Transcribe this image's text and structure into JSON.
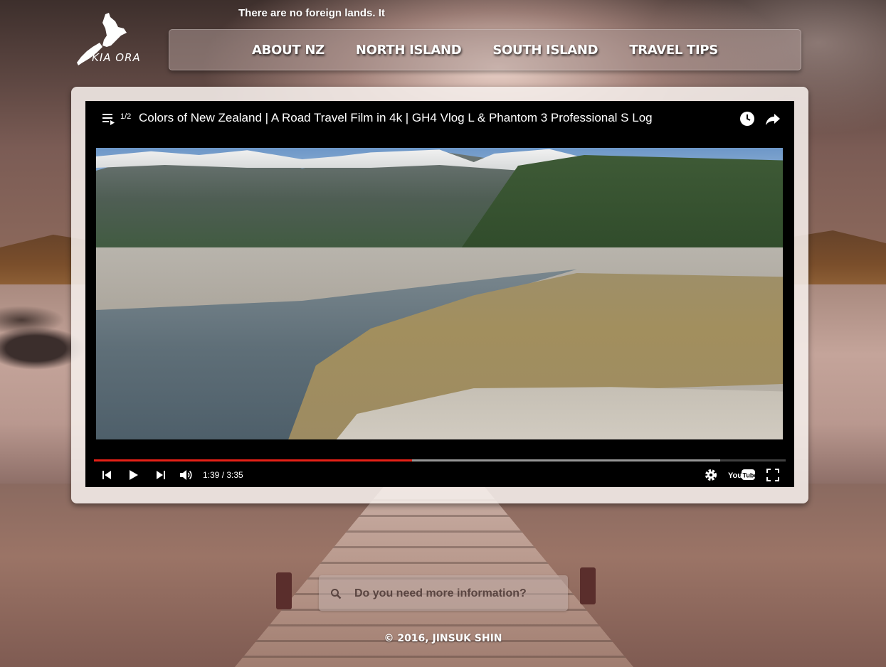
{
  "header": {
    "logo_text": "KIA ORA",
    "ticker_text": "There are no foreign lands. It"
  },
  "nav": {
    "items": [
      {
        "label": "ABOUT NZ"
      },
      {
        "label": "NORTH ISLAND"
      },
      {
        "label": "SOUTH ISLAND"
      },
      {
        "label": "TRAVEL TIPS"
      }
    ]
  },
  "player": {
    "playlist_position": "1/2",
    "title": "Colors of New Zealand | A Road Travel Film in 4k | GH4 Vlog L & Phantom 3 Professional S Log",
    "time_display": "1:39 / 3:35",
    "progress_played": 0.46,
    "progress_buffered": 0.905,
    "icons": [
      "playlist-icon",
      "watch-later-icon",
      "share-icon",
      "previous-icon",
      "play-icon",
      "next-icon",
      "volume-icon",
      "settings-icon",
      "youtube-logo",
      "fullscreen-icon"
    ],
    "accent_color": "#e62117"
  },
  "search": {
    "placeholder": "Do you need more information?"
  },
  "footer": {
    "copyright": "© 2016, JINSUK SHIN"
  }
}
